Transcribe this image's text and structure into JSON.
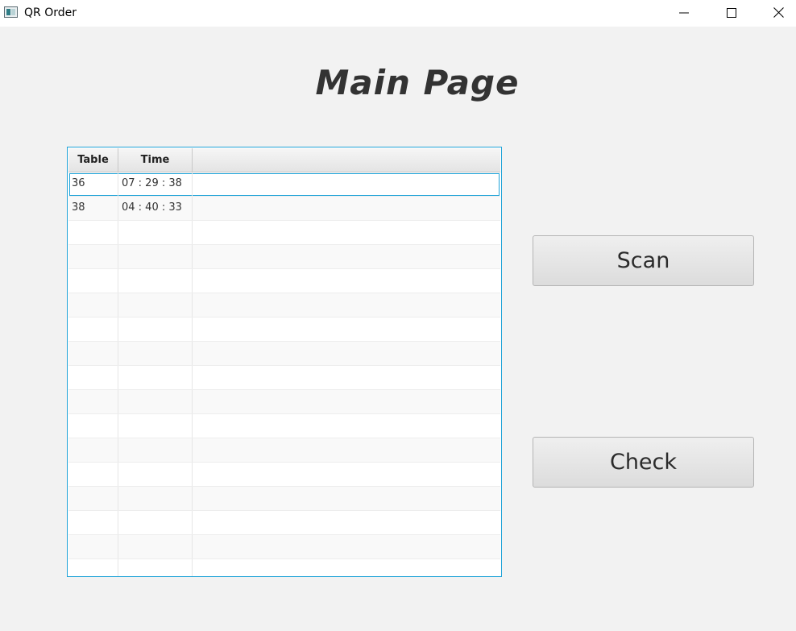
{
  "window": {
    "title": "QR Order"
  },
  "heading": "Main Page",
  "table": {
    "columns": [
      "Table",
      "Time"
    ],
    "rows": [
      {
        "table": "36",
        "time": "07 : 29 : 38"
      },
      {
        "table": "38",
        "time": "04 : 40 : 33"
      }
    ],
    "selected_row": 0
  },
  "buttons": {
    "scan": "Scan",
    "check": "Check"
  },
  "colors": {
    "background": "#f2f2f2",
    "focus_accent": "#1fa3d8"
  },
  "icons": {
    "minimize": "minimize-icon",
    "maximize": "maximize-icon",
    "close": "close-icon",
    "app": "app-window-icon"
  }
}
